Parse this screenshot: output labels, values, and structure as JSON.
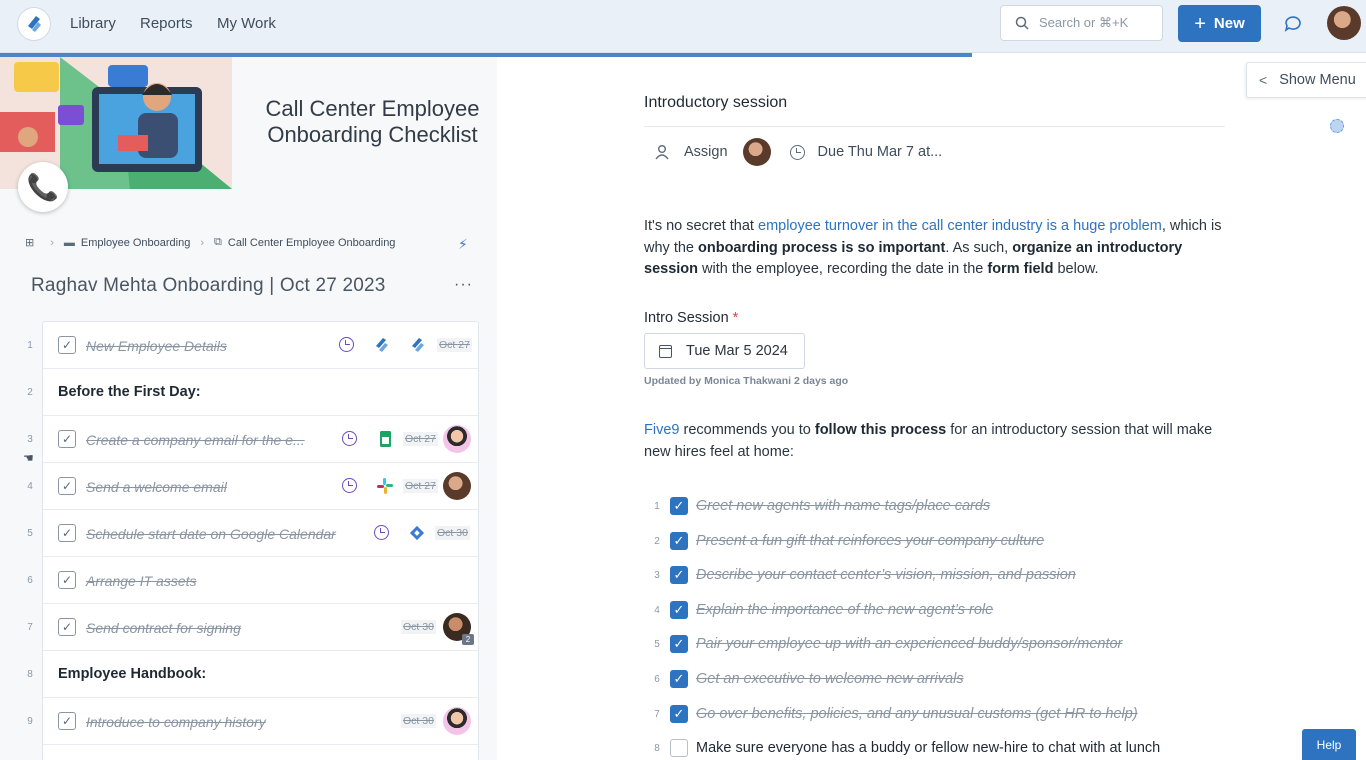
{
  "nav": {
    "links": [
      "Library",
      "Reports",
      "My Work"
    ],
    "search_placeholder": "Search or ⌘+K",
    "new_label": "New",
    "plus": "+"
  },
  "template": {
    "title_line1": "Call Center Employee",
    "title_line2": "Onboarding Checklist"
  },
  "breadcrumb": {
    "folder": "Employee Onboarding",
    "workflow": "Call Center Employee Onboarding"
  },
  "run_title": "Raghav Mehta Onboarding | Oct 27 2023",
  "more": "···",
  "tasks": [
    {
      "num": "1",
      "type": "task",
      "label": "New Employee Details",
      "date": "Oct 27"
    },
    {
      "num": "2",
      "type": "heading",
      "label": "Before the First Day:"
    },
    {
      "num": "3",
      "type": "task",
      "label": "Create a company email for the e...",
      "date": "Oct 27"
    },
    {
      "num": "4",
      "type": "task",
      "label": "Send a welcome email",
      "date": "Oct 27"
    },
    {
      "num": "5",
      "type": "task",
      "label": "Schedule start date on Google Calendar",
      "date": "Oct 30"
    },
    {
      "num": "6",
      "type": "task",
      "label": "Arrange IT assets"
    },
    {
      "num": "7",
      "type": "task",
      "label": "Send contract for signing",
      "date": "Oct 30",
      "badge": "2"
    },
    {
      "num": "8",
      "type": "heading",
      "label": "Employee Handbook:"
    },
    {
      "num": "9",
      "type": "task",
      "label": "Introduce to company history",
      "date": "Oct 30"
    }
  ],
  "step": {
    "title": "Introductory session",
    "assign": "Assign",
    "due": "Due Thu Mar 7 at...",
    "intro_p1_a": "It's no secret that ",
    "intro_p1_link": "employee turnover in the call center industry is a huge problem",
    "intro_p1_b": ", which is why the ",
    "intro_p1_bold1": "onboarding process is so important",
    "intro_p1_c": ". As such, ",
    "intro_p1_bold2": "organize an introductory session",
    "intro_p1_d": " with the employee, recording the date in the ",
    "intro_p1_bold3": "form field",
    "intro_p1_e": " below.",
    "field_label": "Intro Session",
    "required_mark": "*",
    "field_value": "Tue Mar 5 2024",
    "updated": "Updated by Monica Thakwani 2 days ago",
    "p2_link": "Five9",
    "p2_a": " recommends you to ",
    "p2_bold": "follow this process",
    "p2_b": " for an introductory session that will make new hires feel at home:",
    "subtasks": [
      {
        "num": "1",
        "checked": true,
        "label": "Greet new agents with name tags/place cards"
      },
      {
        "num": "2",
        "checked": true,
        "label": "Present a fun gift that reinforces your company culture"
      },
      {
        "num": "3",
        "checked": true,
        "label": "Describe your contact center’s vision, mission, and passion"
      },
      {
        "num": "4",
        "checked": true,
        "label": "Explain the importance of the new agent’s role"
      },
      {
        "num": "5",
        "checked": true,
        "label": "Pair your employee up with an experienced buddy/sponsor/mentor"
      },
      {
        "num": "6",
        "checked": true,
        "label": "Get an executive to welcome new arrivals"
      },
      {
        "num": "7",
        "checked": true,
        "label": "Go over benefits, policies, and any unusual customs (get HR to help)"
      },
      {
        "num": "8",
        "checked": false,
        "label": "Make sure everyone has a buddy or fellow new-hire to chat with at lunch"
      }
    ]
  },
  "show_menu": "Show Menu",
  "help": "Help",
  "colors": {
    "accent": "#2e73c0",
    "clock": "#6a4bc0"
  }
}
